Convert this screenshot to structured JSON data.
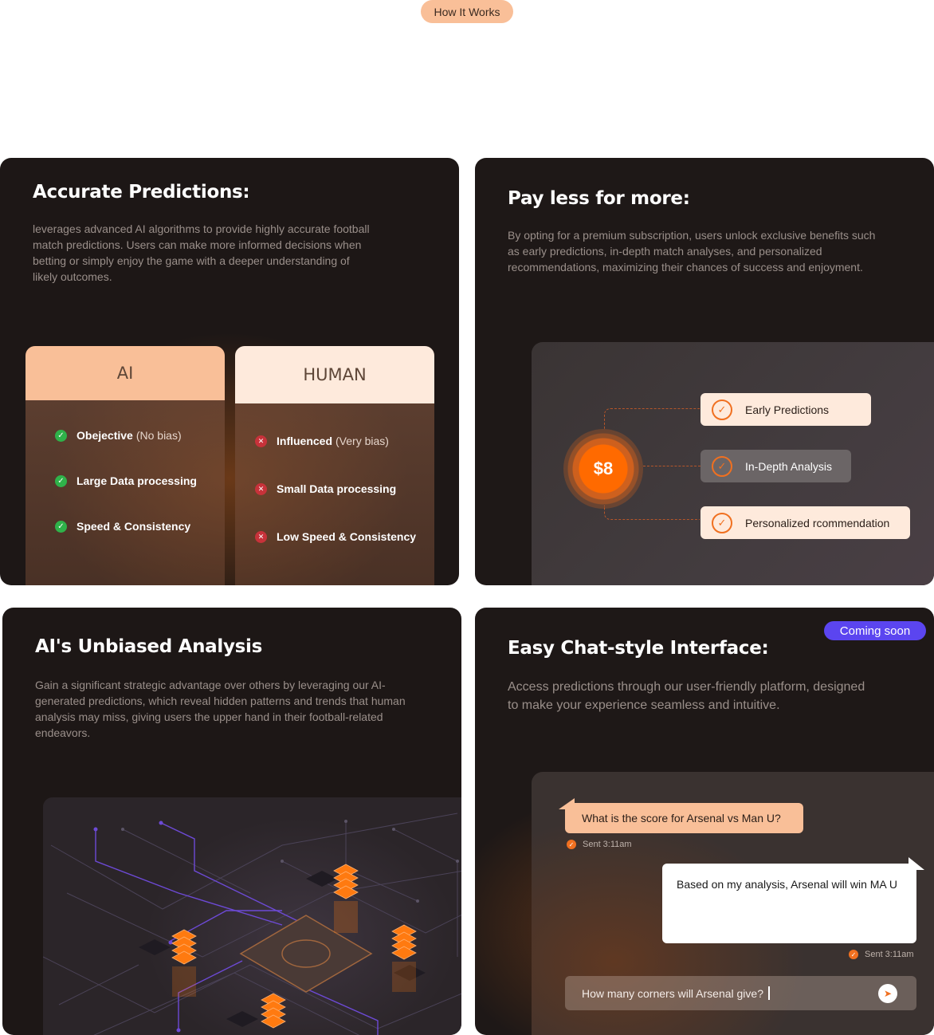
{
  "header": {
    "pill_label": "How It Works"
  },
  "card_predictions": {
    "title": "Accurate Predictions:",
    "description": "leverages advanced AI algorithms to provide highly accurate football match predictions. Users can make more informed decisions when betting or simply enjoy the game with a deeper understanding of likely outcomes.",
    "ai": {
      "heading": "AI",
      "items": [
        {
          "bold": "Obejective",
          "light": "(No bias)"
        },
        {
          "bold": "Large Data processing",
          "light": ""
        },
        {
          "bold": "Speed & Consistency",
          "light": ""
        }
      ]
    },
    "human": {
      "heading": "HUMAN",
      "items": [
        {
          "bold": "Influenced",
          "light": "(Very  bias)"
        },
        {
          "bold": "Small Data processing",
          "light": ""
        },
        {
          "bold": "Low Speed & Consistency",
          "light": ""
        }
      ]
    }
  },
  "card_pricing": {
    "title": "Pay less for more:",
    "description": "By opting for a premium subscription, users unlock exclusive benefits such as early predictions, in-depth match analyses, and personalized recommendations, maximizing their chances of success and enjoyment.",
    "price": "$8",
    "features": [
      "Early Predictions",
      "In-Depth Analysis",
      "Personalized rcommendation"
    ]
  },
  "card_analysis": {
    "title": "AI's Unbiased Analysis",
    "description": "Gain a significant strategic advantage over others by leveraging our AI-generated predictions, which reveal hidden patterns and trends that human analysis may miss, giving users the upper hand in their football-related endeavors."
  },
  "card_chat": {
    "title": "Easy Chat-style Interface:",
    "badge": "Coming soon",
    "description": "Access predictions through our user-friendly platform, designed to make your experience seamless and intuitive.",
    "question": "What is the score for Arsenal vs Man U?",
    "question_sent": "Sent 3:11am",
    "answer": "Based on my analysis, Arsenal will win MA U",
    "answer_sent": "Sent 3:11am",
    "input_value": "How many corners will Arsenal give?"
  },
  "icons": {
    "check": "check-icon",
    "cross": "close-icon",
    "send": "send-icon",
    "server": "server-stack-icon"
  },
  "colors": {
    "accent": "#f07020",
    "peach": "#f9bf98",
    "badge": "#5b45f0"
  }
}
